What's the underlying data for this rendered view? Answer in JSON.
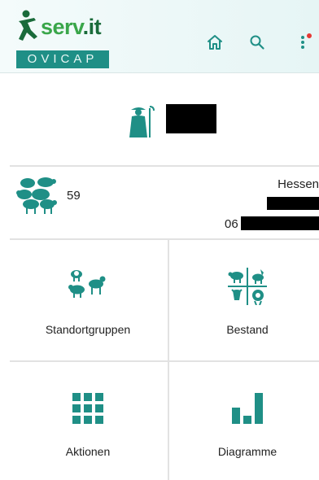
{
  "app": {
    "logo_word_left": "serv",
    "logo_word_right": ".it",
    "logo_badge": "OVICAP"
  },
  "header": {
    "icons": [
      "home-icon",
      "search-icon",
      "more-vert-icon"
    ],
    "notification_dot": true
  },
  "user": {
    "icon": "shepherd-icon",
    "name_redacted": true
  },
  "farm": {
    "icon": "flock-icon",
    "count": "59",
    "state": "Hessen",
    "number_prefix": "06"
  },
  "tiles": [
    {
      "label": "Standortgruppen",
      "icon": "location-groups-icon"
    },
    {
      "label": "Bestand",
      "icon": "stock-icon"
    },
    {
      "label": "Aktionen",
      "icon": "grid-icon"
    },
    {
      "label": "Diagramme",
      "icon": "bar-chart-icon"
    }
  ],
  "colors": {
    "teal": "#1f8f86",
    "logo_green": "#3aa64a",
    "logo_dark_green": "#1a6b3a",
    "notification_red": "#e53935",
    "divider": "#e2e2e2"
  }
}
